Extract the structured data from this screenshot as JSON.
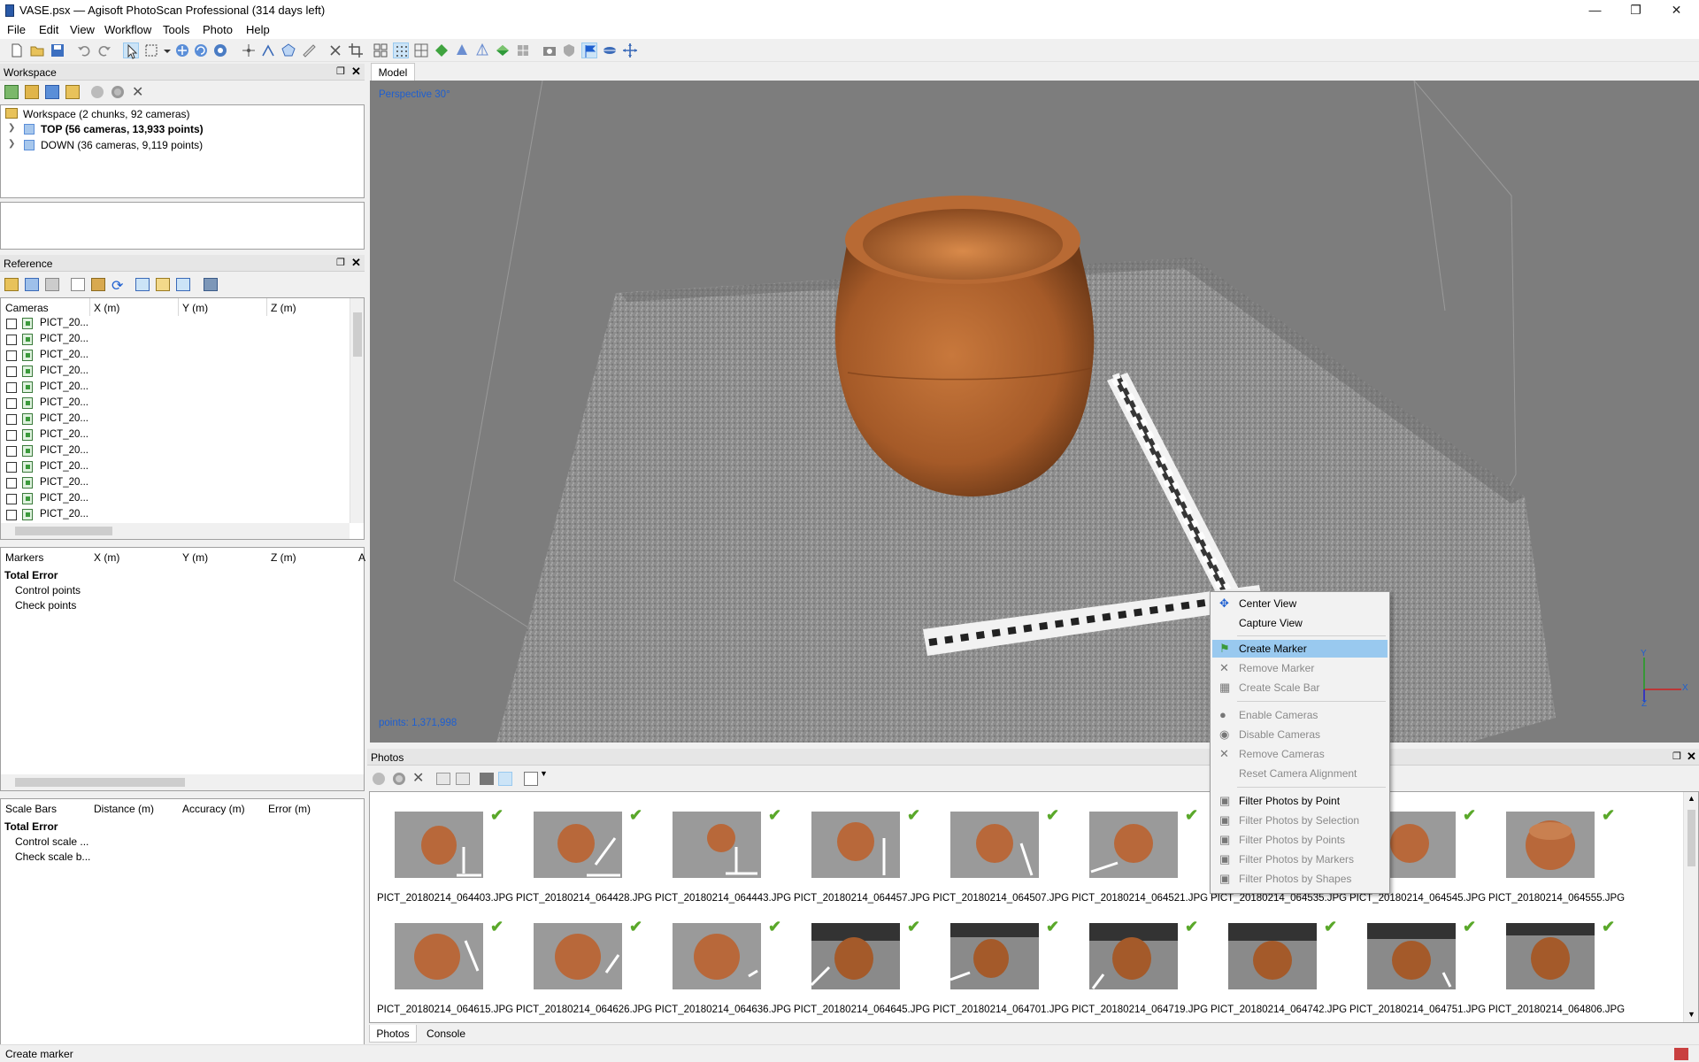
{
  "window": {
    "title": "VASE.psx — Agisoft PhotoScan Professional (314 days left)",
    "controls": [
      "minimize-icon",
      "restore-icon",
      "close-icon"
    ]
  },
  "menubar": {
    "items": [
      "File",
      "Edit",
      "View",
      "Workflow",
      "Tools",
      "Photo",
      "Help"
    ]
  },
  "workspace": {
    "title": "Workspace",
    "root": "Workspace (2 chunks, 92 cameras)",
    "chunks": [
      "TOP (56 cameras, 13,933 points)",
      "DOWN (36 cameras, 9,119 points)"
    ]
  },
  "reference": {
    "title": "Reference",
    "cameras_headers": [
      "Cameras",
      "X (m)",
      "Y (m)",
      "Z (m)"
    ],
    "cameras": [
      "PICT_20...",
      "PICT_20...",
      "PICT_20...",
      "PICT_20...",
      "PICT_20...",
      "PICT_20...",
      "PICT_20...",
      "PICT_20...",
      "PICT_20...",
      "PICT_20...",
      "PICT_20...",
      "PICT_20...",
      "PICT_20..."
    ],
    "markers_headers": [
      "Markers",
      "X (m)",
      "Y (m)",
      "Z (m)",
      "A"
    ],
    "markers_rows": {
      "total": "Total Error",
      "control": "Control points",
      "check": "Check points"
    },
    "scalebars_headers": [
      "Scale Bars",
      "Distance (m)",
      "Accuracy (m)",
      "Error (m)"
    ],
    "scalebars_rows": {
      "total": "Total Error",
      "control": "Control scale ...",
      "check": "Check scale b..."
    }
  },
  "model": {
    "tab": "Model",
    "perspective": "Perspective 30°",
    "points": "points: 1,371,998",
    "axes": {
      "x": "X",
      "y": "Y",
      "z": "Z"
    }
  },
  "context_menu": {
    "items": [
      {
        "label": "Center View",
        "icon": "move-icon",
        "enabled": true
      },
      {
        "label": "Capture View",
        "icon": "",
        "enabled": true
      },
      {
        "label": "Create Marker",
        "icon": "marker-flag-icon",
        "enabled": true,
        "highlighted": true
      },
      {
        "label": "Remove Marker",
        "icon": "x-icon",
        "enabled": false
      },
      {
        "label": "Create Scale Bar",
        "icon": "scalebar-icon",
        "enabled": false
      },
      {
        "label": "Enable Cameras",
        "icon": "enable-icon",
        "enabled": false
      },
      {
        "label": "Disable Cameras",
        "icon": "disable-icon",
        "enabled": false
      },
      {
        "label": "Remove Cameras",
        "icon": "x-icon",
        "enabled": false
      },
      {
        "label": "Reset Camera Alignment",
        "icon": "",
        "enabled": false
      },
      {
        "label": "Filter Photos by Point",
        "icon": "filter-icon",
        "enabled": true
      },
      {
        "label": "Filter Photos by Selection",
        "icon": "filter-icon",
        "enabled": false
      },
      {
        "label": "Filter Photos by Points",
        "icon": "filter-icon",
        "enabled": false
      },
      {
        "label": "Filter Photos by Markers",
        "icon": "filter-icon",
        "enabled": false
      },
      {
        "label": "Filter Photos by Shapes",
        "icon": "filter-icon",
        "enabled": false
      }
    ]
  },
  "photos": {
    "title": "Photos",
    "row1": [
      "PICT_20180214_064403.JPG",
      "PICT_20180214_064428.JPG",
      "PICT_20180214_064443.JPG",
      "PICT_20180214_064457.JPG",
      "PICT_20180214_064507.JPG",
      "PICT_20180214_064521.JPG",
      "PICT_20180214_064535.JPG",
      "PICT_20180214_064545.JPG",
      "PICT_20180214_064555.JPG"
    ],
    "row2": [
      "PICT_20180214_064615.JPG",
      "PICT_20180214_064626.JPG",
      "PICT_20180214_064636.JPG",
      "PICT_20180214_064645.JPG",
      "PICT_20180214_064701.JPG",
      "PICT_20180214_064719.JPG",
      "PICT_20180214_064742.JPG",
      "PICT_20180214_064751.JPG",
      "PICT_20180214_064806.JPG"
    ]
  },
  "bottom_tabs": [
    "Photos",
    "Console"
  ],
  "statusbar": {
    "text": "Create marker"
  },
  "colors": {
    "highlight": "#99c9ef",
    "viewport_bg": "#7d7d7d",
    "accent_blue": "#1e5fd0"
  }
}
